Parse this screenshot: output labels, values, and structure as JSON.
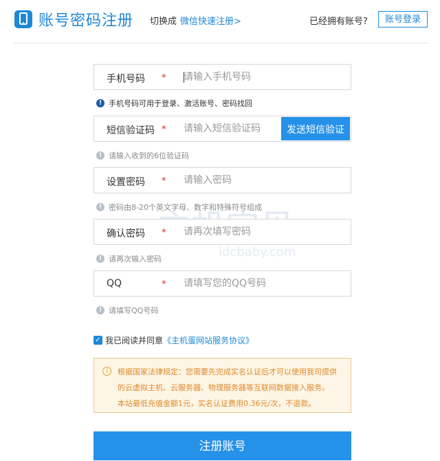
{
  "header": {
    "title": "账号密码注册",
    "switch_label": "切换成",
    "switch_link": "微信快速注册>",
    "has_account": "已经拥有账号?",
    "login_button": "账号登录"
  },
  "fields": [
    {
      "label": "手机号码",
      "required": "*",
      "placeholder": "请输入手机号码",
      "hint": "手机号码可用于登录、激活账号、密码找回"
    },
    {
      "label": "短信验证码",
      "required": "*",
      "placeholder": "请输入短信验证码",
      "button": "发送短信验证",
      "hint": "请输入收到的6位验证码"
    },
    {
      "label": "设置密码",
      "required": "*",
      "placeholder": "请输入密码",
      "hint": "密码由8-20个英文字母、数字和特殊符号组成"
    },
    {
      "label": "确认密码",
      "required": "*",
      "placeholder": "请再次填写密码",
      "hint": "请再次输入密码"
    },
    {
      "label": "QQ",
      "required": "*",
      "placeholder": "请填写您的QQ号码",
      "hint": "请填写QQ号码"
    }
  ],
  "hint_icon": "!",
  "agreement": {
    "checked": true,
    "check_glyph": "✓",
    "prefix": "我已阅读并同意",
    "link": "《主机蛋网站服务协议》"
  },
  "notice": {
    "icon": "i",
    "lines": [
      "根据国家法律规定：您需要先完成实名认证后才可以使用我司提供",
      "的云虚拟主机、云服务器、物理服务器等互联网数据接入服务。",
      "本站最低充值金额1元，实名认证费用0.36元/次，不退款。"
    ]
  },
  "submit_label": "注册账号",
  "watermark": {
    "main": "主机宝贝",
    "sub": "idcbaby.com"
  },
  "colors": {
    "accent": "#2591e8",
    "required": "#e02020",
    "notice_text": "#e08a2a"
  }
}
